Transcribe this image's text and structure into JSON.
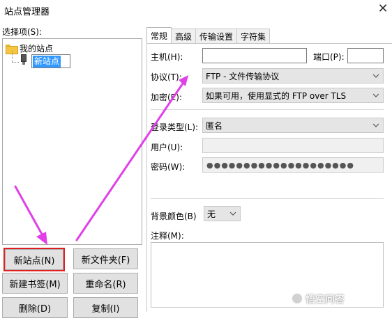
{
  "window": {
    "title": "站点管理器",
    "close_glyph": "✕"
  },
  "left": {
    "select_label": "选择项(S):",
    "tree": {
      "root_label": "我的站点",
      "child_label": "新站点"
    },
    "buttons": {
      "new_site": "新站点(N)",
      "new_folder": "新文件夹(F)",
      "new_bookmark": "新建书签(M)",
      "rename": "重命名(R)",
      "delete": "删除(D)",
      "copy": "复制(I)"
    }
  },
  "tabs": [
    "常规",
    "高级",
    "传输设置",
    "字符集"
  ],
  "general": {
    "host_label": "主机(H):",
    "host_value": "",
    "port_label": "端口(P):",
    "port_value": "",
    "protocol_label": "协议(T):",
    "protocol_value": "FTP - 文件传输协议",
    "encryption_label": "加密(E):",
    "encryption_value": "如果可用，使用显式的 FTP over TLS",
    "logon_type_label": "登录类型(L):",
    "logon_type_value": "匿名",
    "user_label": "用户(U):",
    "password_label": "密码(W):",
    "password_mask": "●●●●●●●●●●●●●●●●●●●●",
    "bg_color_label": "背景颜色(B)",
    "bg_color_value": "无",
    "comments_label": "注释(M):"
  },
  "watermark": "悟空问答",
  "colors": {
    "highlight_box": "#e02020",
    "arrow": "#e040e8",
    "selection": "#3399ff"
  }
}
